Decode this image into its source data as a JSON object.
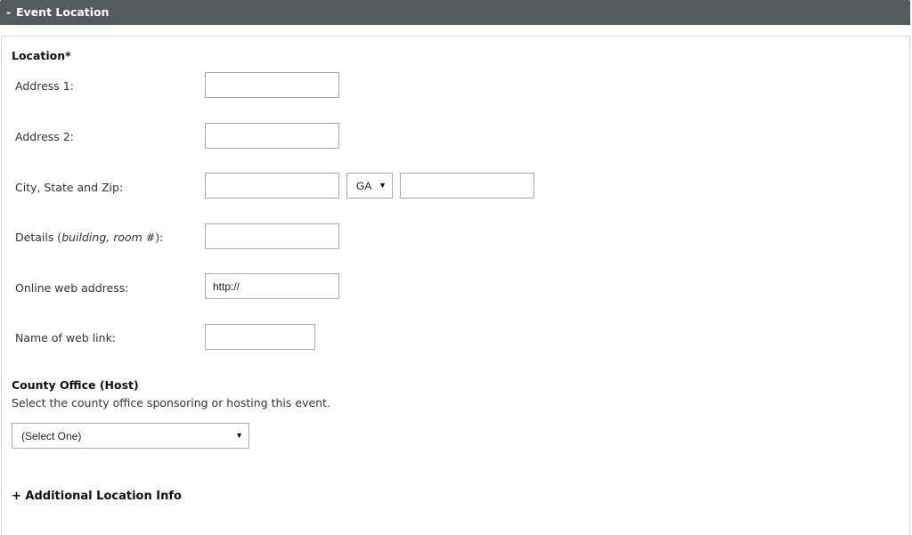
{
  "header": {
    "toggle": "-",
    "title": "Event Location"
  },
  "location": {
    "heading": "Location*",
    "address1": {
      "label": "Address 1:",
      "value": ""
    },
    "address2": {
      "label": "Address 2:",
      "value": ""
    },
    "city_state_zip": {
      "label": "City, State and Zip:",
      "city": "",
      "state": "GA",
      "zip": ""
    },
    "details": {
      "label_prefix": "Details (",
      "label_italic": "building, room #",
      "label_suffix": "):",
      "value": ""
    },
    "web_address": {
      "label": "Online web address:",
      "value": "http://"
    },
    "web_link_name": {
      "label": "Name of web link:",
      "value": ""
    }
  },
  "county": {
    "heading": "County Office (Host)",
    "help": "Select the county office sponsoring or hosting this event.",
    "selected": "(Select One)"
  },
  "additional": {
    "label": "+ Additional Location Info"
  },
  "icons": {
    "dropdown": "caret-down-icon"
  }
}
